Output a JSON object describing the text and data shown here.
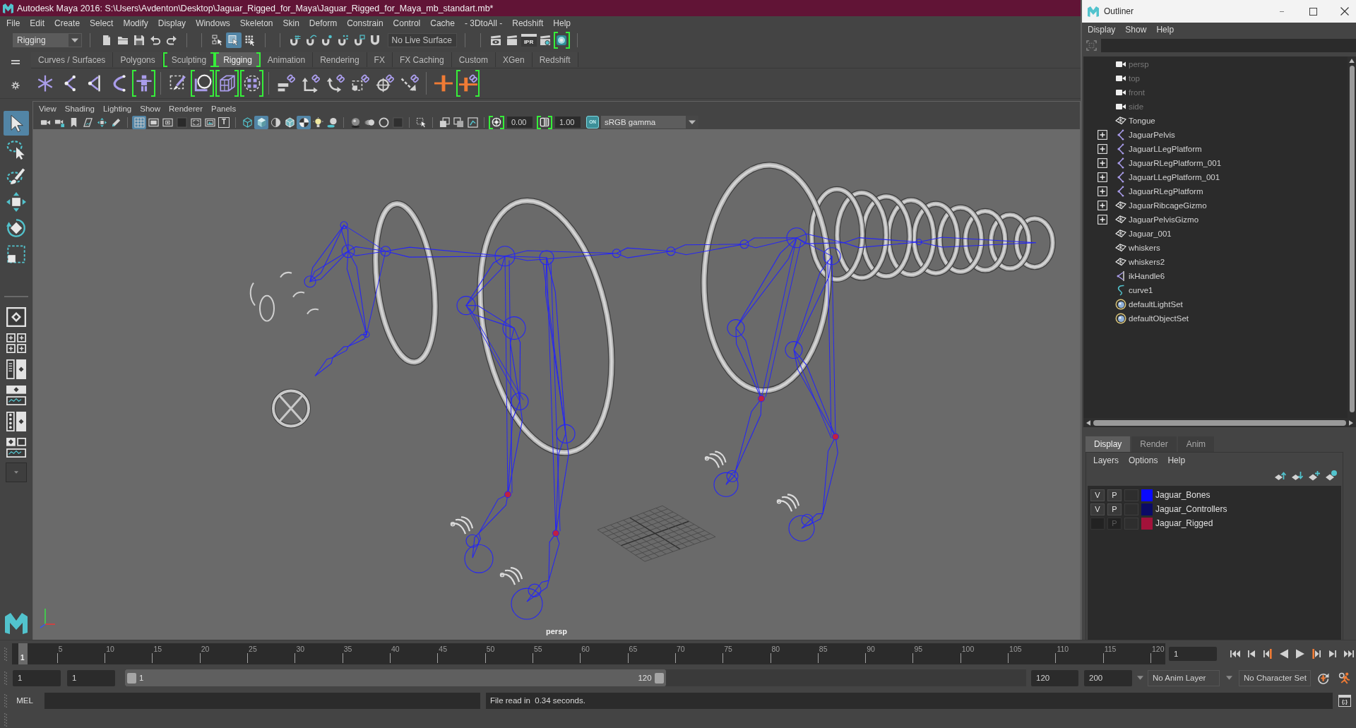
{
  "window": {
    "title": "Autodesk Maya 2016: S:\\Users\\Avdenton\\Desktop\\Jaguar_Rigged_for_Maya\\Jaguar_Rigged_for_Maya_mb_standart.mb*"
  },
  "menu_bar": [
    "File",
    "Edit",
    "Create",
    "Select",
    "Modify",
    "Display",
    "Windows",
    "Skeleton",
    "Skin",
    "Deform",
    "Constrain",
    "Control",
    "Cache",
    "- 3DtoAll -",
    "Redshift",
    "Help"
  ],
  "status_line": {
    "menu_set": "Rigging",
    "selection_modes": [
      {
        "kind": "hierarchy",
        "selected": false
      },
      {
        "kind": "object",
        "selected": true
      },
      {
        "kind": "component",
        "selected": false
      }
    ],
    "live_surface": "No Live Surface",
    "render_tools": [
      {
        "kind": "render-view",
        "bracketed": false
      },
      {
        "kind": "render",
        "bracketed": false
      },
      {
        "kind": "ipr",
        "text": "IPR",
        "bracketed": false
      },
      {
        "kind": "render-settings",
        "bracketed": false
      },
      {
        "kind": "hypershade",
        "bracketed": true
      }
    ]
  },
  "shelf": {
    "tabs": [
      {
        "label": "Curves / Surfaces",
        "selected": false,
        "bracketed": false
      },
      {
        "label": "Polygons",
        "selected": false,
        "bracketed": false
      },
      {
        "label": "Sculpting",
        "selected": false,
        "bracketed": true
      },
      {
        "label": "Rigging",
        "selected": true,
        "bracketed": true
      },
      {
        "label": "Animation",
        "selected": false,
        "bracketed": false
      },
      {
        "label": "Rendering",
        "selected": false,
        "bracketed": false
      },
      {
        "label": "FX",
        "selected": false,
        "bracketed": false
      },
      {
        "label": "FX Caching",
        "selected": false,
        "bracketed": false
      },
      {
        "label": "Custom",
        "selected": false,
        "bracketed": false
      },
      {
        "label": "XGen",
        "selected": false,
        "bracketed": false
      },
      {
        "label": "Redshift",
        "selected": false,
        "bracketed": false
      }
    ],
    "tool_groups": [
      [
        {
          "kind": "star-joint",
          "bracketed": false
        },
        {
          "kind": "angle-joint",
          "bracketed": false
        },
        {
          "kind": "ik-handle",
          "bracketed": false
        },
        {
          "kind": "ik-spline",
          "bracketed": false
        },
        {
          "kind": "figure",
          "bracketed": true
        }
      ],
      [
        {
          "kind": "dashed-brush",
          "bracketed": false
        },
        {
          "kind": "sphere-corner",
          "bracketed": true
        },
        {
          "kind": "lattice",
          "bracketed": true
        },
        {
          "kind": "cluster",
          "bracketed": true
        }
      ],
      [
        {
          "kind": "link-bars",
          "bracketed": false
        },
        {
          "kind": "link-corner",
          "bracketed": false
        },
        {
          "kind": "link-curve",
          "bracketed": false
        },
        {
          "kind": "link-dashed",
          "bracketed": false
        },
        {
          "kind": "link-target",
          "bracketed": false
        },
        {
          "kind": "link-diagonal",
          "bracketed": false
        }
      ],
      [
        {
          "kind": "cross-bar",
          "bracketed": false
        },
        {
          "kind": "link-bar",
          "bracketed": true
        }
      ]
    ]
  },
  "toolbox": {
    "tools": [
      {
        "kind": "select",
        "selected": true
      },
      {
        "kind": "lasso",
        "selected": false
      },
      {
        "kind": "paint",
        "selected": false
      },
      {
        "kind": "move",
        "selected": false
      },
      {
        "kind": "rotate",
        "selected": false
      },
      {
        "kind": "scale",
        "selected": false
      }
    ]
  },
  "panel": {
    "menu": [
      "View",
      "Shading",
      "Lighting",
      "Show",
      "Renderer",
      "Panels"
    ],
    "tool_groups": [
      [
        {
          "kind": "camera",
          "selected": false
        },
        {
          "kind": "camera-lock",
          "selected": false
        },
        {
          "kind": "bookmark",
          "selected": false
        },
        {
          "kind": "image-plane",
          "selected": false
        },
        {
          "kind": "pan-zoom",
          "selected": false
        },
        {
          "kind": "pencil",
          "selected": false
        }
      ],
      [
        {
          "kind": "grid",
          "selected": true
        },
        {
          "kind": "film-gate",
          "selected": false
        },
        {
          "kind": "resolution-gate",
          "selected": false
        },
        {
          "kind": "gate-mask",
          "selected": false
        },
        {
          "kind": "field-chart",
          "selected": false
        },
        {
          "kind": "safe-action",
          "selected": false
        },
        {
          "kind": "safe-title",
          "text": "T",
          "selected": false
        }
      ],
      [
        {
          "kind": "wireframe",
          "selected": false
        },
        {
          "kind": "shaded",
          "selected": true
        },
        {
          "kind": "material",
          "selected": false
        },
        {
          "kind": "wire-shaded",
          "selected": false
        },
        {
          "kind": "textured",
          "selected": true
        },
        {
          "kind": "lights",
          "selected": false
        },
        {
          "kind": "shadows",
          "selected": false
        }
      ],
      [
        {
          "kind": "occlusion",
          "selected": false
        },
        {
          "kind": "motion-blur",
          "selected": false
        },
        {
          "kind": "anti-alias",
          "selected": false
        },
        {
          "kind": "depth-of-field",
          "selected": false
        }
      ],
      [
        {
          "kind": "isolate",
          "selected": false
        }
      ],
      [
        {
          "kind": "xray",
          "selected": false
        },
        {
          "kind": "xray-active",
          "selected": false
        },
        {
          "kind": "xray-joints",
          "selected": false
        }
      ]
    ],
    "exposure": {
      "value": "0.00",
      "bracketed": true
    },
    "gamma": {
      "value": "1.00",
      "bracketed": true
    },
    "color_management": {
      "label": "ON",
      "on": true
    },
    "view_transform": "sRGB gamma",
    "camera": "persp"
  },
  "outliner": {
    "title": "Outliner",
    "menu": [
      "Display",
      "Show",
      "Help"
    ],
    "items": [
      {
        "label": "persp",
        "kind": "camera",
        "dimmed": true,
        "expandable": false
      },
      {
        "label": "top",
        "kind": "camera",
        "dimmed": true,
        "expandable": false
      },
      {
        "label": "front",
        "kind": "camera",
        "dimmed": true,
        "expandable": false
      },
      {
        "label": "side",
        "kind": "camera",
        "dimmed": true,
        "expandable": false
      },
      {
        "label": "Tongue",
        "kind": "mesh",
        "dimmed": false,
        "expandable": false
      },
      {
        "label": "JaguarPelvis",
        "kind": "joint",
        "dimmed": false,
        "expandable": true
      },
      {
        "label": "JaguarLLegPlatform",
        "kind": "joint",
        "dimmed": false,
        "expandable": true
      },
      {
        "label": "JaguarRLegPlatform_001",
        "kind": "joint",
        "dimmed": false,
        "expandable": true
      },
      {
        "label": "JaguarLLegPlatform_001",
        "kind": "joint",
        "dimmed": false,
        "expandable": true
      },
      {
        "label": "JaguarRLegPlatform",
        "kind": "joint",
        "dimmed": false,
        "expandable": true
      },
      {
        "label": "JaguarRibcageGizmo",
        "kind": "mesh",
        "dimmed": false,
        "expandable": true
      },
      {
        "label": "JaguarPelvisGizmo",
        "kind": "mesh",
        "dimmed": false,
        "expandable": true
      },
      {
        "label": "Jaguar_001",
        "kind": "mesh",
        "dimmed": false,
        "expandable": false
      },
      {
        "label": "whiskers",
        "kind": "mesh",
        "dimmed": false,
        "expandable": false
      },
      {
        "label": "whiskers2",
        "kind": "mesh",
        "dimmed": false,
        "expandable": false
      },
      {
        "label": "ikHandle6",
        "kind": "ik",
        "dimmed": false,
        "expandable": false
      },
      {
        "label": "curve1",
        "kind": "curve",
        "dimmed": false,
        "expandable": false
      },
      {
        "label": "defaultLightSet",
        "kind": "set",
        "dimmed": false,
        "expandable": false
      },
      {
        "label": "defaultObjectSet",
        "kind": "set",
        "dimmed": false,
        "expandable": false
      }
    ],
    "layer_editor": {
      "tabs": [
        {
          "label": "Display",
          "selected": true
        },
        {
          "label": "Render",
          "selected": false
        },
        {
          "label": "Anim",
          "selected": false
        }
      ],
      "menu": [
        "Layers",
        "Options",
        "Help"
      ],
      "layers": [
        {
          "name": "Jaguar_Bones",
          "color": "#0a0aff",
          "toggles": [
            {
              "text": "V",
              "on": true
            },
            {
              "text": "P",
              "on": true
            }
          ]
        },
        {
          "name": "Jaguar_Controllers",
          "color": "#0b0b66",
          "toggles": [
            {
              "text": "V",
              "on": true
            },
            {
              "text": "P",
              "on": true
            }
          ]
        },
        {
          "name": "Jaguar_Rigged",
          "color": "#a3123a",
          "toggles": [
            {
              "on": false
            },
            {
              "text": "P",
              "on": false
            }
          ]
        }
      ]
    }
  },
  "time_slider": {
    "tick_labels": [
      "5",
      "10",
      "15",
      "20",
      "25",
      "30",
      "35",
      "40",
      "45",
      "50",
      "55",
      "60",
      "65",
      "70",
      "75",
      "80",
      "85",
      "90",
      "95",
      "100",
      "105",
      "110",
      "115",
      "120"
    ],
    "current_frame_marker": "1",
    "current_frame": "1"
  },
  "range_slider": {
    "start": "1",
    "playback_start": "1",
    "range_start": "1",
    "range_end": "120",
    "level": 0.6,
    "playback_end": "120",
    "end": "200",
    "anim_layer": "No Anim Layer",
    "character_set": "No Character Set"
  },
  "command_line": {
    "language": "MEL",
    "result": "File read in  0.34 seconds.",
    "script_editor": "{;}"
  }
}
